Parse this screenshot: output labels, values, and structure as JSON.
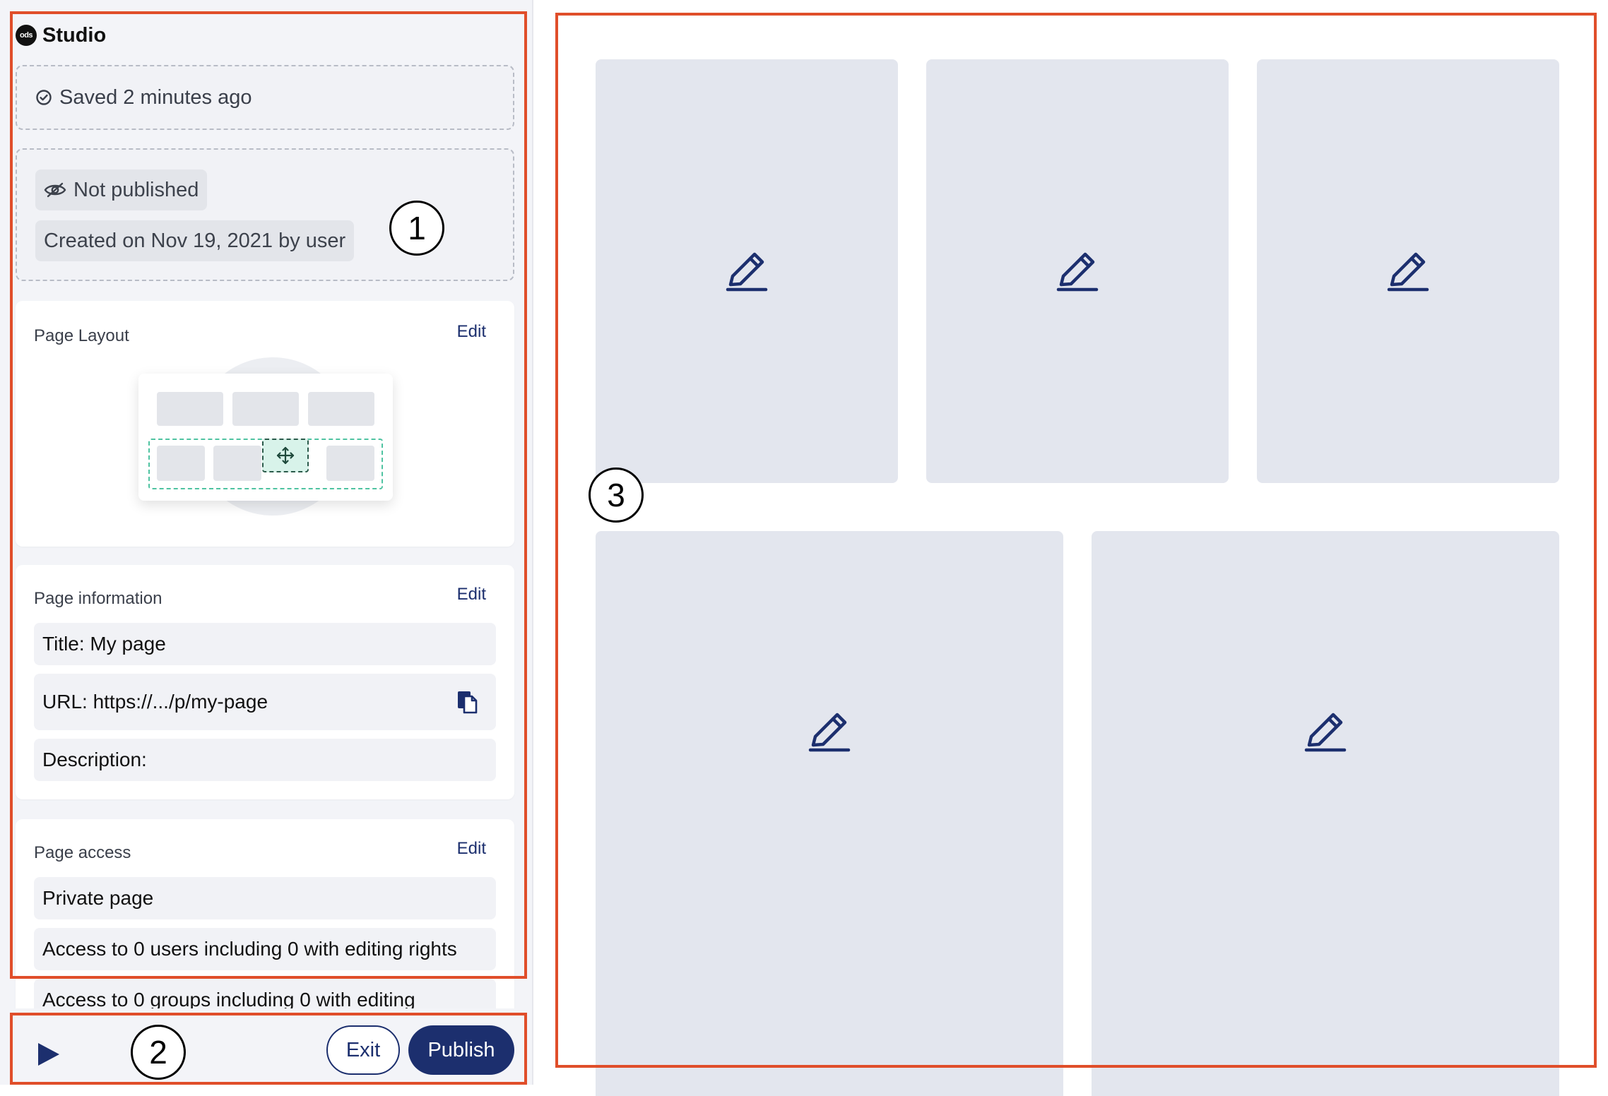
{
  "app": {
    "brand_logo": "ods",
    "brand_name": "Studio"
  },
  "status": {
    "saved": "Saved 2 minutes ago",
    "published": "Not published",
    "created": "Created on Nov 19, 2021 by user"
  },
  "layout_card": {
    "title": "Page Layout",
    "edit": "Edit"
  },
  "info_card": {
    "title": "Page information",
    "edit": "Edit",
    "page_title": "Title: My page",
    "url": "URL: https://.../p/my-page",
    "description": "Description:"
  },
  "access_card": {
    "title": "Page access",
    "edit": "Edit",
    "privacy": "Private page",
    "users": "Access to 0 users including 0 with editing rights",
    "groups": "Access to 0 groups including 0 with editing"
  },
  "bottom_bar": {
    "exit": "Exit",
    "publish": "Publish"
  },
  "annotations": [
    "1",
    "2",
    "3"
  ],
  "colors": {
    "accent": "#1c2f6e",
    "annotation": "#e04e2a",
    "tile": "#e3e6ee",
    "sidebar_bg": "#f3f4f8"
  },
  "icons": [
    "check-circle-icon",
    "eye-off-icon",
    "move-icon",
    "copy-icon",
    "play-icon",
    "pencil-icon"
  ]
}
